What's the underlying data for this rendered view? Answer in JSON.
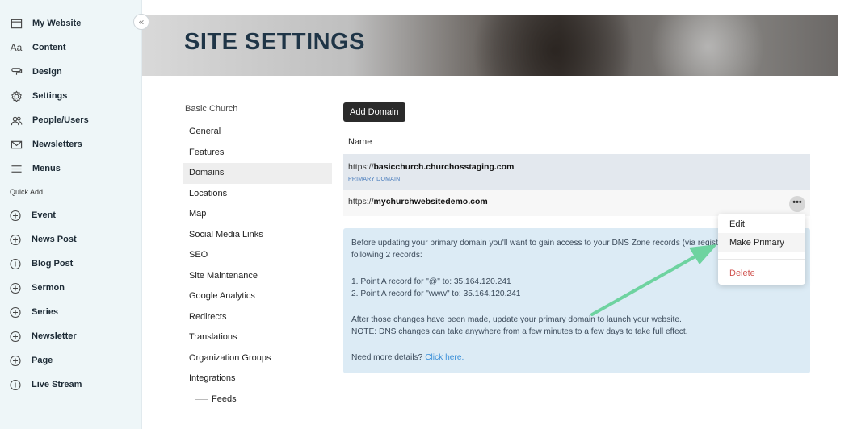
{
  "sidebar": {
    "items": [
      {
        "label": "My Website",
        "icon": "browser-window-icon"
      },
      {
        "label": "Content",
        "icon": "text-aa-icon"
      },
      {
        "label": "Design",
        "icon": "paint-roller-icon"
      },
      {
        "label": "Settings",
        "icon": "gear-icon"
      },
      {
        "label": "People/Users",
        "icon": "people-icon"
      },
      {
        "label": "Newsletters",
        "icon": "envelope-icon"
      },
      {
        "label": "Menus",
        "icon": "hamburger-menu-icon"
      }
    ],
    "quick_add_label": "Quick Add",
    "quick_add": [
      "Event",
      "News Post",
      "Blog Post",
      "Sermon",
      "Series",
      "Newsletter",
      "Page",
      "Live Stream"
    ],
    "collapse_glyph": "«"
  },
  "banner": {
    "title": "SITE SETTINGS"
  },
  "settings_nav": {
    "heading": "Basic Church",
    "items": [
      "General",
      "Features",
      "Domains",
      "Locations",
      "Map",
      "Social Media Links",
      "SEO",
      "Site Maintenance",
      "Google Analytics",
      "Redirects",
      "Translations",
      "Organization Groups",
      "Integrations"
    ],
    "active": "Domains",
    "sub_items": [
      "Feeds"
    ]
  },
  "main": {
    "add_button": "Add Domain",
    "column_header": "Name",
    "domains": [
      {
        "prefix": "https://",
        "host": "basicchurch.churchosstaging.com",
        "tag": "PRIMARY DOMAIN"
      },
      {
        "prefix": "https://",
        "host": "mychurchwebsitedemo.com",
        "more": "•••"
      }
    ],
    "info": {
      "p1": "Before updating your primary domain you'll want to gain access to your DNS Zone records (via registrar) and adjust the following 2 records:",
      "r1": "1. Point A record for \"@\" to: 35.164.120.241",
      "r2": "2. Point A record for \"www\" to: 35.164.120.241",
      "p2": "After those changes have been made, update your primary domain to launch your website.",
      "p3": "NOTE: DNS changes can take anywhere from a few minutes to a few days to take full effect.",
      "p4_prefix": "Need more details?",
      "p4_link": "Click here."
    }
  },
  "dropdown": {
    "items": [
      "Edit",
      "Make Primary"
    ],
    "danger": "Delete"
  },
  "colors": {
    "sidebar_bg": "#eef6f8",
    "info_bg": "#dcebf5",
    "arrow": "#6ed3a0",
    "delete": "#d0534f",
    "primary_tag": "#4a7dbd"
  }
}
